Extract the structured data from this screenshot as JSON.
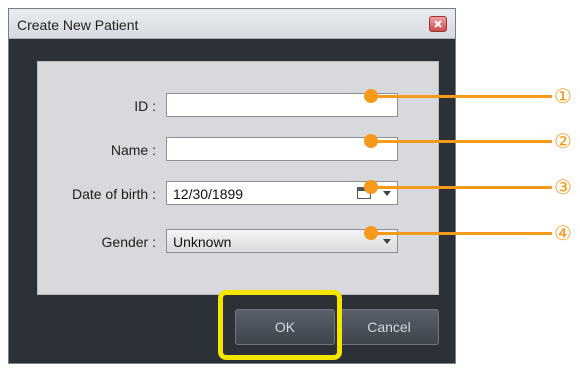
{
  "dialog": {
    "title": "Create New Patient",
    "fields": [
      {
        "label": "ID :",
        "value": ""
      },
      {
        "label": "Name :",
        "value": ""
      },
      {
        "label": "Date of birth :",
        "value": "12/30/1899"
      },
      {
        "label": "Gender :",
        "value": "Unknown"
      }
    ],
    "ok_label": "OK",
    "cancel_label": "Cancel"
  },
  "annotations": {
    "callouts": [
      "①",
      "②",
      "③",
      "④"
    ],
    "color": "#f59a1b",
    "highlight_color": "#f5e300"
  },
  "icons": {
    "close": "close-icon",
    "calendar": "calendar-icon",
    "dropdown": "chevron-down-icon"
  }
}
